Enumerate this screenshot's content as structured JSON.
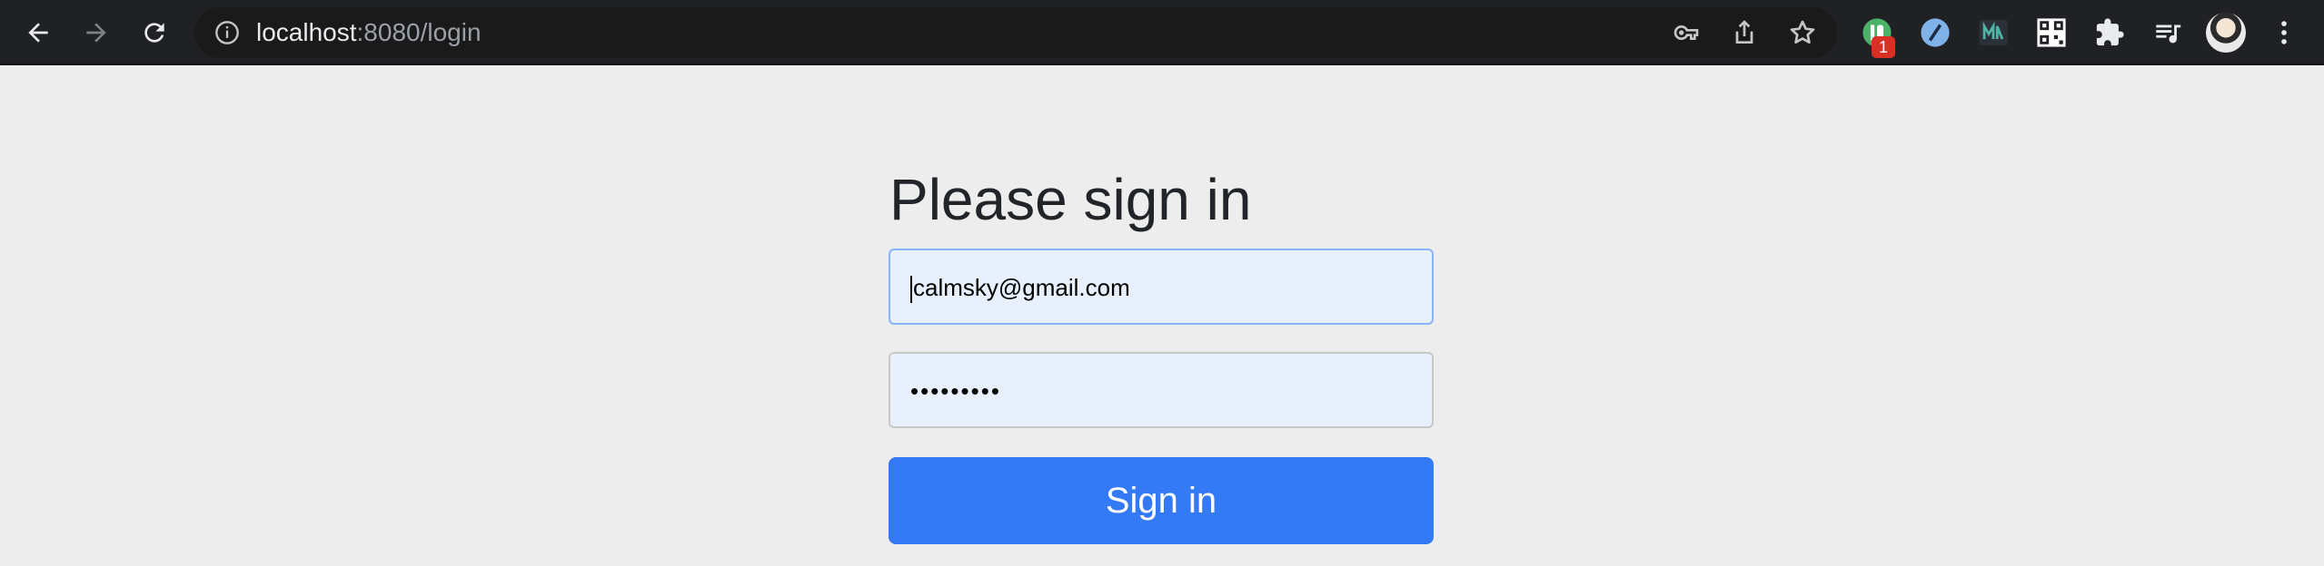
{
  "browser": {
    "url_host": "localhost",
    "url_rest": ":8080/login",
    "extension_badge": "1"
  },
  "form": {
    "heading": "Please sign in",
    "email_value": "calmsky@gmail.com",
    "password_value": "•••••••••",
    "submit_label": "Sign in"
  },
  "colors": {
    "accent": "#3479f6",
    "field_bg": "#e8f0fe",
    "page_bg": "#ededed",
    "toolbar_bg": "#202124"
  }
}
